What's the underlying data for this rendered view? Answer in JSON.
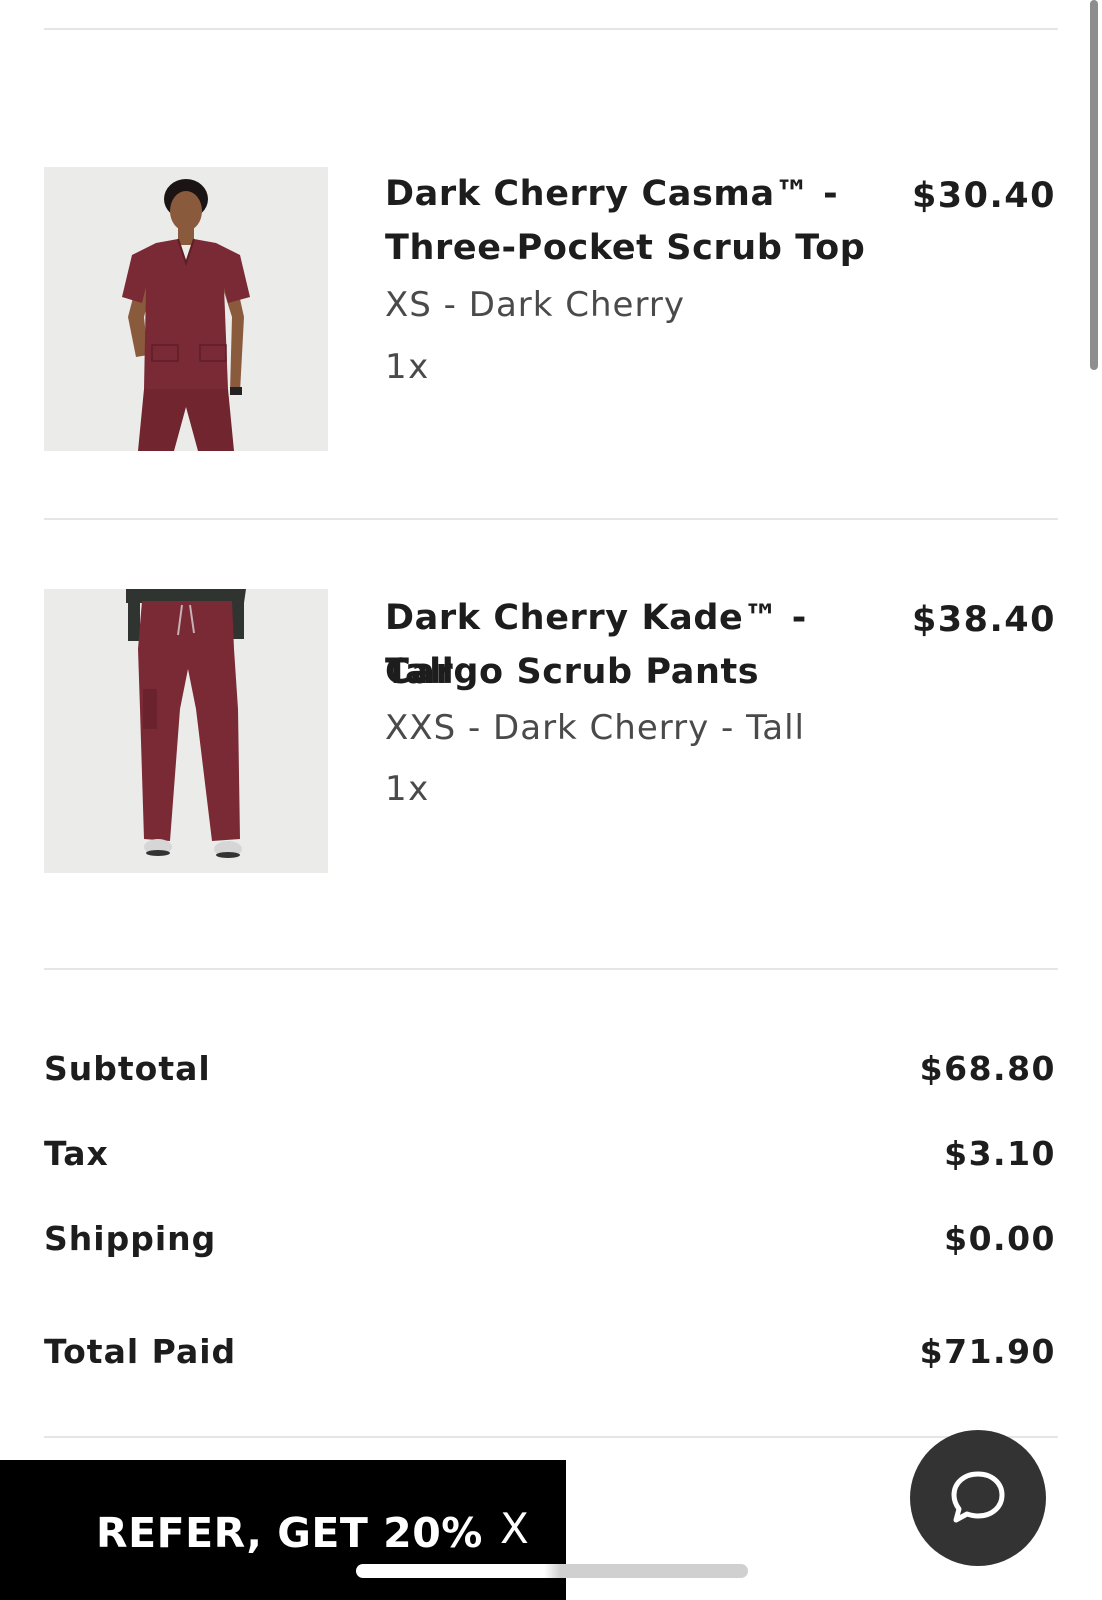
{
  "order": {
    "items": [
      {
        "name_line1": "Dark Cherry Casma™ -",
        "name_line2": "Three-Pocket Scrub Top",
        "variant": "XS - Dark Cherry",
        "quantity": "1x",
        "price": "$30.40",
        "image_icon": "scrub-top-photo"
      },
      {
        "name_line1": "Dark Cherry Kade™ - Tall",
        "name_line2": "Cargo Scrub Pants",
        "variant": "XXS - Dark Cherry - Tall",
        "quantity": "1x",
        "price": "$38.40",
        "image_icon": "scrub-pants-photo"
      }
    ],
    "summary": {
      "subtotal_label": "Subtotal",
      "subtotal_value": "$68.80",
      "tax_label": "Tax",
      "tax_value": "$3.10",
      "shipping_label": "Shipping",
      "shipping_value": "$0.00",
      "total_label": "Total Paid",
      "total_value": "$71.90"
    }
  },
  "refer_banner": {
    "text": "REFER, GET 20%",
    "close_label": "X"
  },
  "chat": {
    "icon": "chat-bubble-icon"
  },
  "colors": {
    "product_color": "#7a2a35",
    "banner_bg": "#000000",
    "chat_bg": "#333333",
    "divider": "#e6e6e6"
  }
}
